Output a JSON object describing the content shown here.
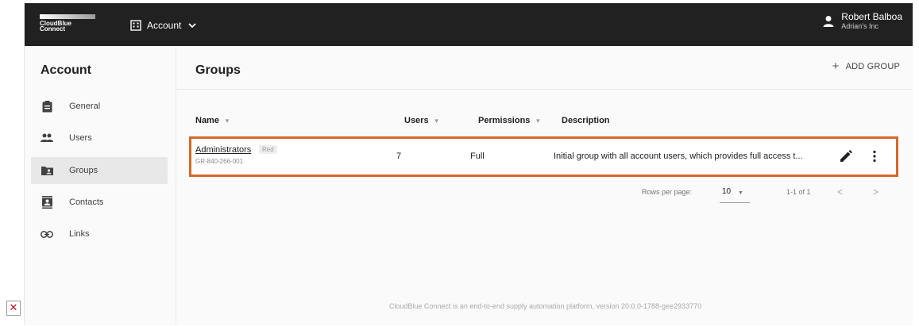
{
  "topbar": {
    "logo_line1": "CloudBlue",
    "logo_line2": "Connect",
    "account_label": "Account",
    "user_name": "Robert Balboa",
    "user_org": "Adrian's Inc"
  },
  "sidebar": {
    "title": "Account",
    "active": "Groups",
    "items": [
      {
        "label": "General",
        "icon": "clipboard-icon"
      },
      {
        "label": "Users",
        "icon": "people-icon"
      },
      {
        "label": "Groups",
        "icon": "folder-account-icon"
      },
      {
        "label": "Contacts",
        "icon": "contacts-icon"
      },
      {
        "label": "Links",
        "icon": "link-icon"
      }
    ]
  },
  "main": {
    "title": "Groups",
    "add_label": "ADD GROUP",
    "table": {
      "columns": [
        "Name",
        "Users",
        "Permissions",
        "Description"
      ],
      "rows": [
        {
          "name": "Administrators",
          "badge": "Red",
          "id": "GR-840-266-001",
          "users": "7",
          "permissions": "Full",
          "description": "Initial group with all account users, which provides full access t..."
        }
      ]
    },
    "pagination": {
      "rows_per_page_label": "Rows per page:",
      "rows_per_page": "10",
      "range": "1-1 of 1",
      "prev": "<",
      "next": ">"
    },
    "footer": "CloudBlue Connect is an end-to-end supply automation platform, version 20.0.0-1788-gee2933770"
  },
  "colors": {
    "topbar": "#212121",
    "highlight": "#d4692a",
    "active_nav": "#e8e8e8"
  }
}
